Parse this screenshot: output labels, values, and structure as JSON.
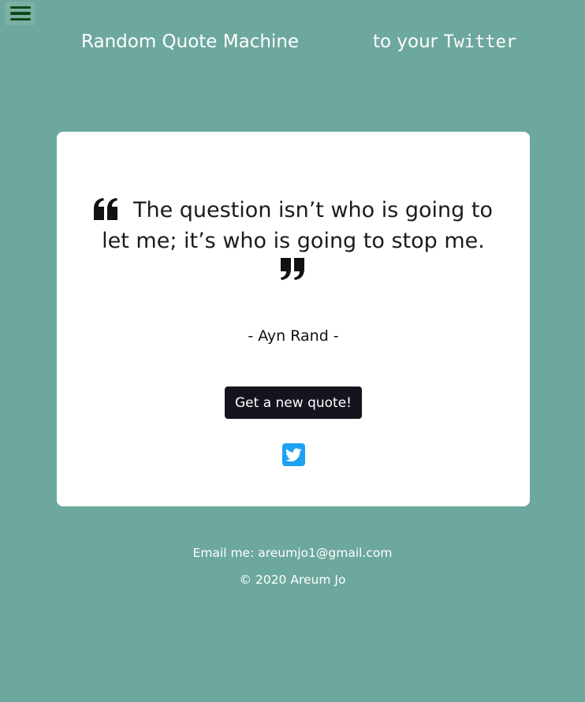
{
  "nav": {
    "menu_icon": "hamburger-icon"
  },
  "header": {
    "title": "Random Quote Machine",
    "tagline_prefix": "to your ",
    "tagline_mono": "Twitter"
  },
  "quote": {
    "text": "The question isn’t who is going to let me; it’s who is going to stop me.",
    "author": "- Ayn Rand -",
    "open_icon": "quote-left-icon",
    "close_icon": "quote-right-icon"
  },
  "actions": {
    "new_quote_label": "Get a new quote!",
    "tweet_icon": "twitter-icon"
  },
  "footer": {
    "email_line": "Email me: areumjo1@gmail.com",
    "copyright": "© 2020 Areum Jo"
  },
  "colors": {
    "background": "#6DA89E",
    "card": "#FFFFFF",
    "button": "#16131F",
    "twitter": "#1DA1F2",
    "menu_bars": "#0E4A1A"
  }
}
